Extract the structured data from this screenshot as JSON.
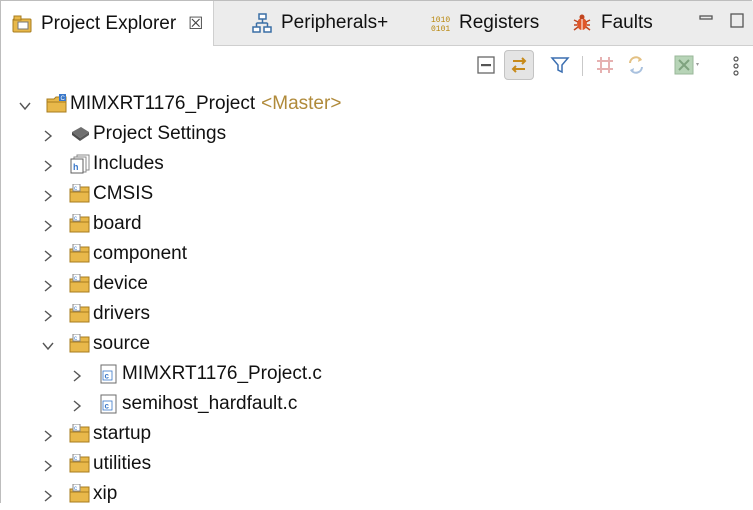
{
  "tabs": [
    {
      "label": "Project Explorer",
      "close": "☒",
      "active": true
    },
    {
      "label": "Peripherals+",
      "active": false
    },
    {
      "label": "Registers",
      "active": false
    },
    {
      "label": "Faults",
      "active": false
    }
  ],
  "window_controls": [
    "minimize-icon",
    "maximize-icon"
  ],
  "toolbar": {
    "buttons": [
      "collapse-all-icon",
      "link-with-editor-icon",
      "filter-icon",
      "grid-icon",
      "sync-icon",
      "disabled-build-icon",
      "view-menu-icon"
    ]
  },
  "tree": {
    "project": {
      "label": "MIMXRT1176_Project",
      "suffix": "<Master>"
    },
    "items": [
      {
        "label": "Project Settings"
      },
      {
        "label": "Includes"
      },
      {
        "label": "CMSIS"
      },
      {
        "label": "board"
      },
      {
        "label": "component"
      },
      {
        "label": "device"
      },
      {
        "label": "drivers"
      },
      {
        "label": "source"
      },
      {
        "label": "MIMXRT1176_Project.c"
      },
      {
        "label": "semihost_hardfault.c"
      },
      {
        "label": "startup"
      },
      {
        "label": "utilities"
      },
      {
        "label": "xip"
      }
    ]
  },
  "colors": {
    "folder": "#e8b84a",
    "suffix": "#b08a3a",
    "tab_bg": "#ececec"
  }
}
